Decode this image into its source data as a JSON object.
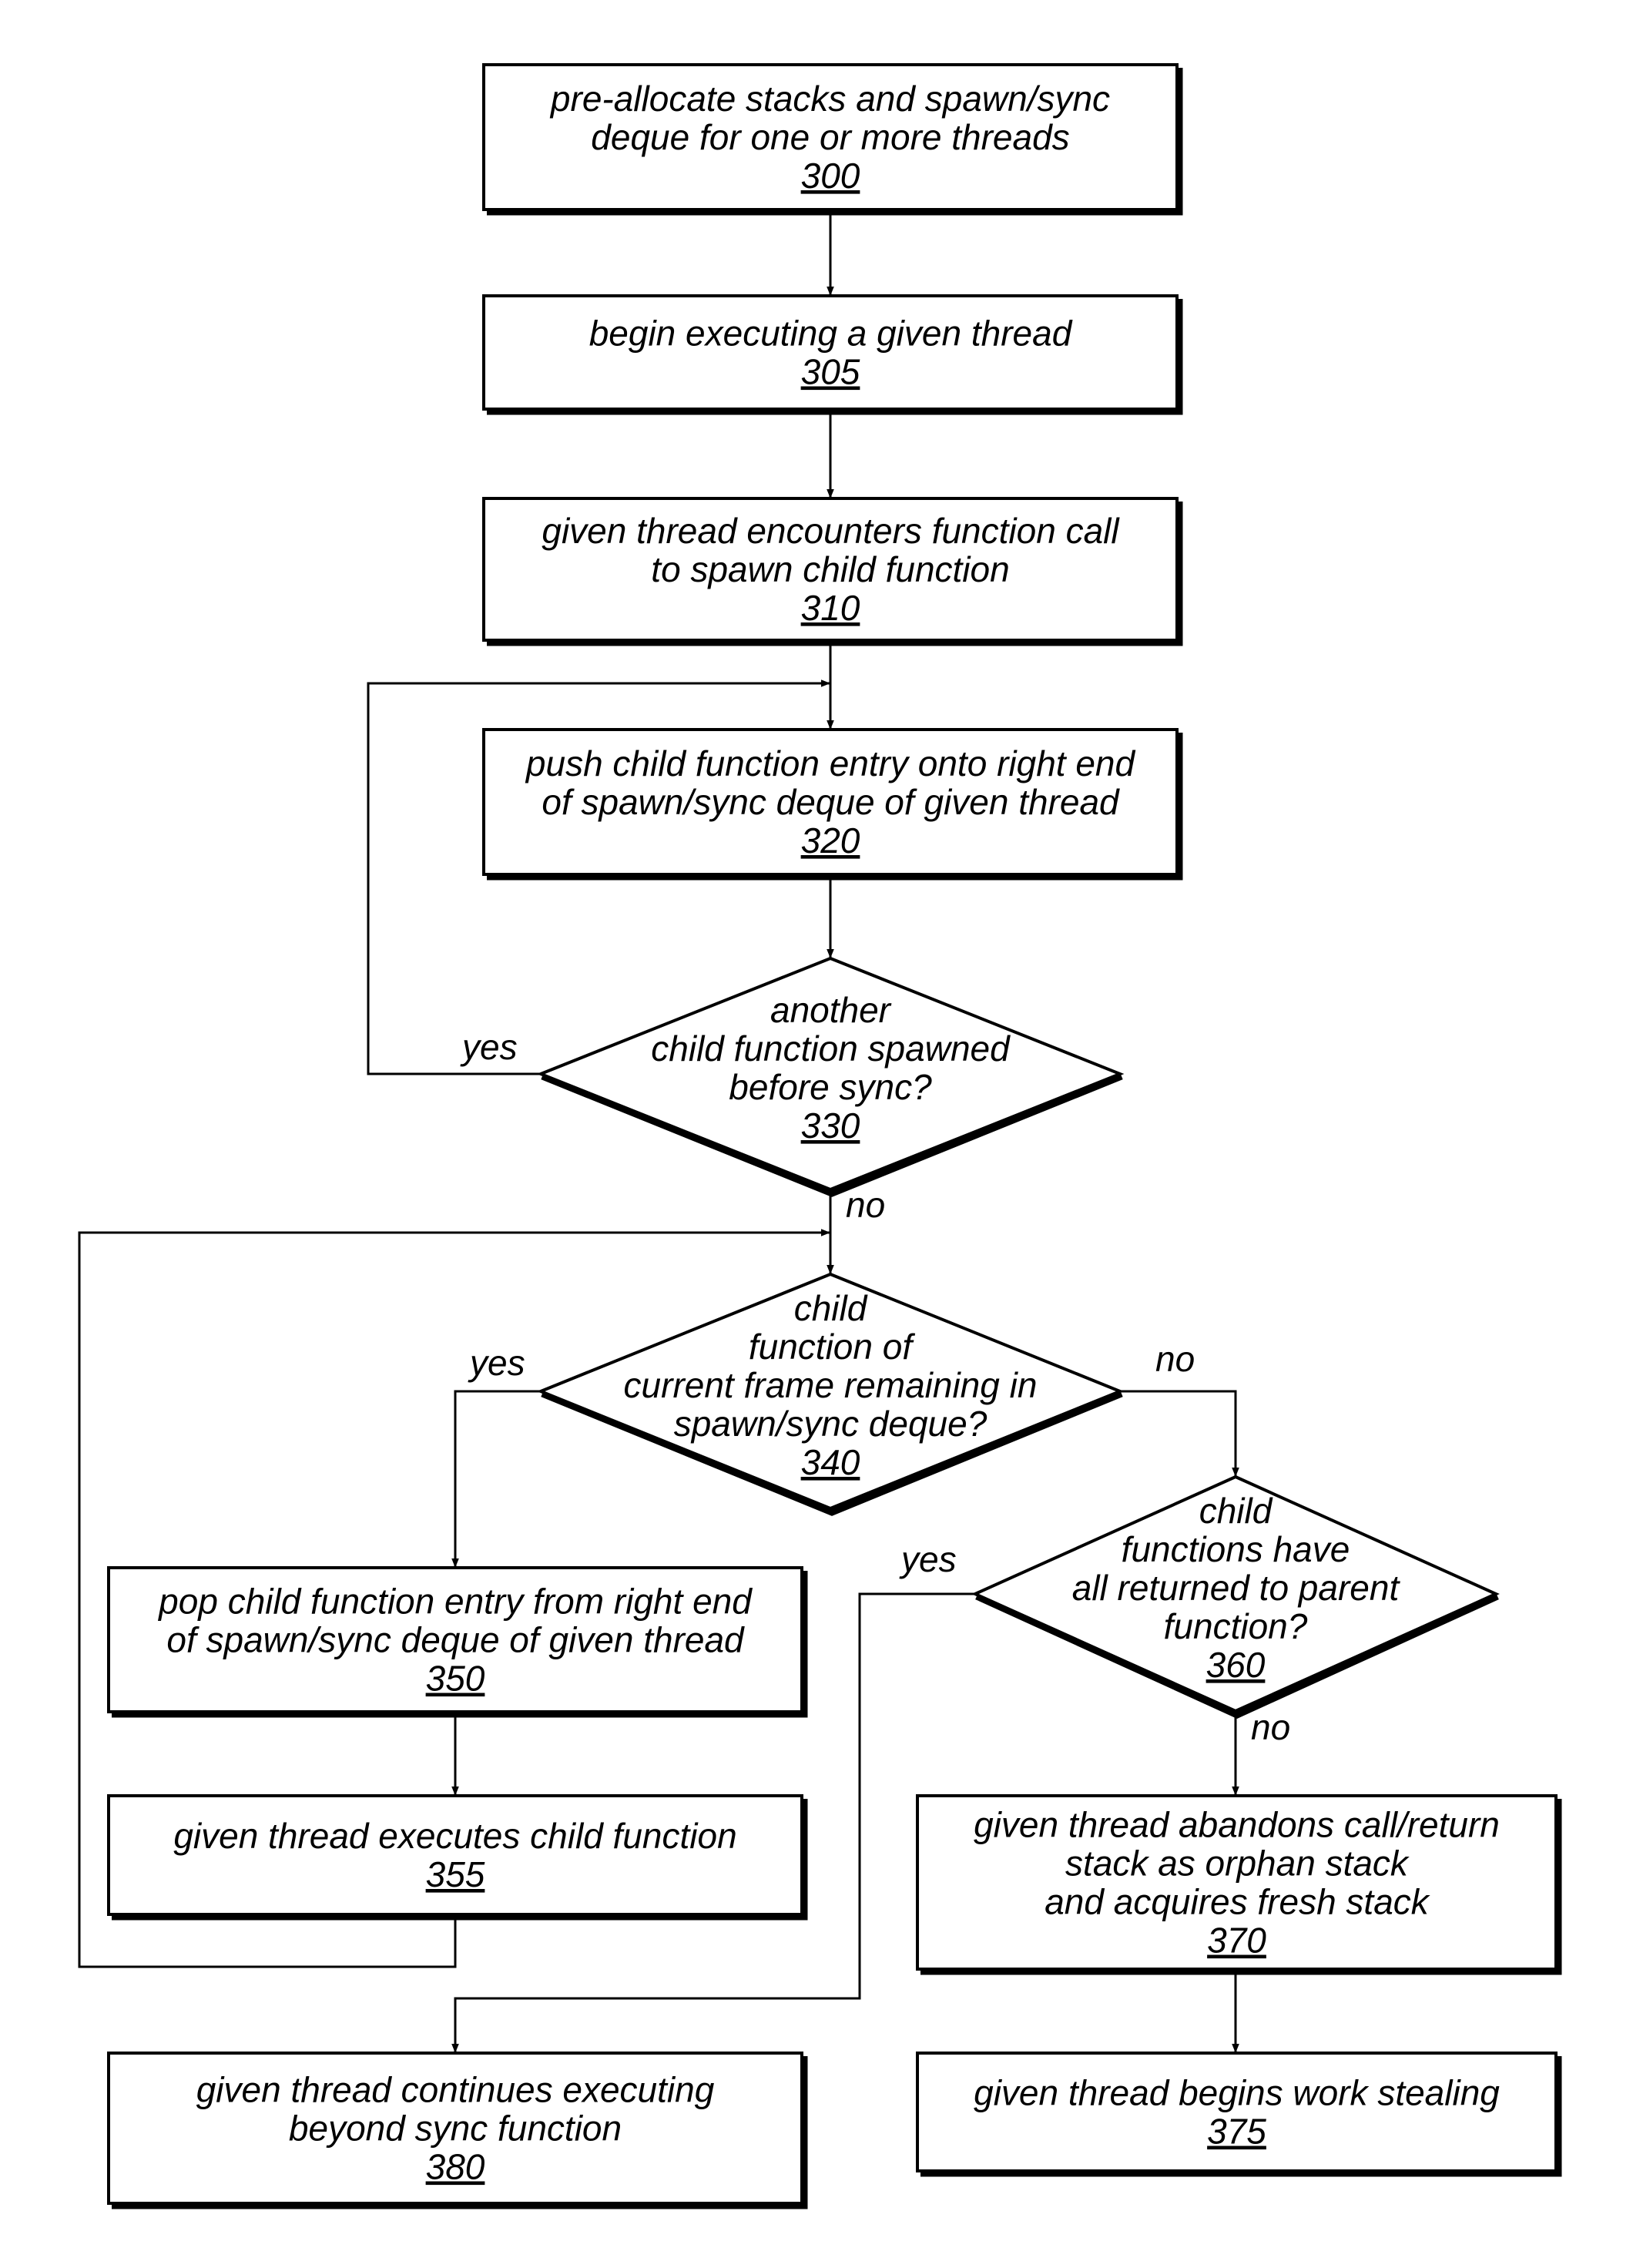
{
  "nodes": [
    {
      "id": "300",
      "type": "process",
      "lines": [
        "pre-allocate stacks and spawn/sync",
        "deque for one or more threads"
      ],
      "ref": "300"
    },
    {
      "id": "305",
      "type": "process",
      "lines": [
        "begin executing a given thread"
      ],
      "ref": "305"
    },
    {
      "id": "310",
      "type": "process",
      "lines": [
        "given thread encounters function call",
        "to spawn child function"
      ],
      "ref": "310"
    },
    {
      "id": "320",
      "type": "process",
      "lines": [
        "push child function entry onto right end",
        "of spawn/sync deque of given thread"
      ],
      "ref": "320"
    },
    {
      "id": "330",
      "type": "decision",
      "lines": [
        "another",
        "child function spawned",
        "before sync?"
      ],
      "ref": "330"
    },
    {
      "id": "340",
      "type": "decision",
      "lines": [
        "child",
        "function of",
        "current frame remaining in",
        "spawn/sync deque?"
      ],
      "ref": "340"
    },
    {
      "id": "350",
      "type": "process",
      "lines": [
        "pop child function entry from right end",
        "of spawn/sync deque of given thread"
      ],
      "ref": "350"
    },
    {
      "id": "355",
      "type": "process",
      "lines": [
        "given thread executes child function"
      ],
      "ref": "355"
    },
    {
      "id": "360",
      "type": "decision",
      "lines": [
        "child",
        "functions have",
        "all returned to parent",
        "function?"
      ],
      "ref": "360"
    },
    {
      "id": "370",
      "type": "process",
      "lines": [
        "given thread abandons call/return",
        "stack as orphan stack",
        "and acquires fresh stack"
      ],
      "ref": "370"
    },
    {
      "id": "375",
      "type": "process",
      "lines": [
        "given thread begins work stealing"
      ],
      "ref": "375"
    },
    {
      "id": "380",
      "type": "process",
      "lines": [
        "given thread continues executing",
        "beyond sync function"
      ],
      "ref": "380"
    }
  ],
  "edges": [
    {
      "from": "300",
      "to": "305",
      "label": ""
    },
    {
      "from": "305",
      "to": "310",
      "label": ""
    },
    {
      "from": "310",
      "to": "320",
      "label": ""
    },
    {
      "from": "320",
      "to": "330",
      "label": ""
    },
    {
      "from": "330",
      "to": "320",
      "label": "yes"
    },
    {
      "from": "330",
      "to": "340",
      "label": "no"
    },
    {
      "from": "340",
      "to": "350",
      "label": "yes"
    },
    {
      "from": "340",
      "to": "360",
      "label": "no"
    },
    {
      "from": "350",
      "to": "355",
      "label": ""
    },
    {
      "from": "355",
      "to": "340",
      "label": ""
    },
    {
      "from": "360",
      "to": "380",
      "label": "yes"
    },
    {
      "from": "360",
      "to": "370",
      "label": "no"
    },
    {
      "from": "370",
      "to": "375",
      "label": ""
    }
  ]
}
